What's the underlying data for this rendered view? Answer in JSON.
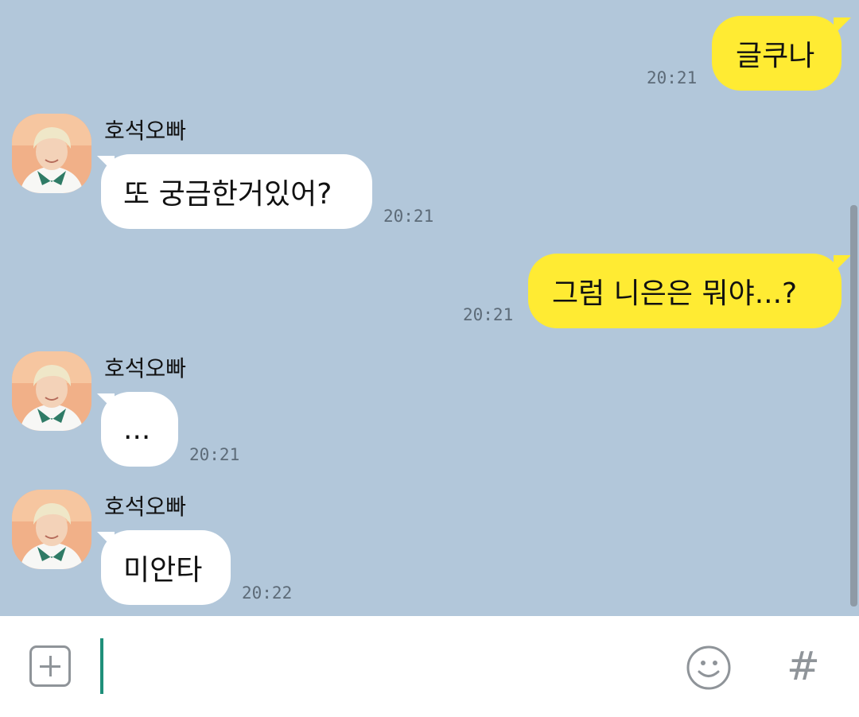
{
  "contact": {
    "name": "호석오빠"
  },
  "messages": [
    {
      "from": "me",
      "text": "글쿠나",
      "time": "20:21"
    },
    {
      "from": "other",
      "sender": "호석오빠",
      "text": "또 궁금한거있어?",
      "time": "20:21"
    },
    {
      "from": "me",
      "text": "그럼 니은은 뭐야...?",
      "time": "20:21"
    },
    {
      "from": "other",
      "sender": "호석오빠",
      "text": "...",
      "time": "20:21"
    },
    {
      "from": "other",
      "sender": "호석오빠",
      "text": "미안타",
      "time": "20:22"
    }
  ],
  "input": {
    "value": "",
    "placeholder": ""
  },
  "icons": {
    "attach": "plus-box-icon",
    "emoticon": "smiley-icon",
    "hashtag": "#"
  },
  "colors": {
    "chat_background": "#b2c7da",
    "my_bubble": "#ffeb33",
    "their_bubble": "#ffffff",
    "caret": "#1f8f7a"
  }
}
